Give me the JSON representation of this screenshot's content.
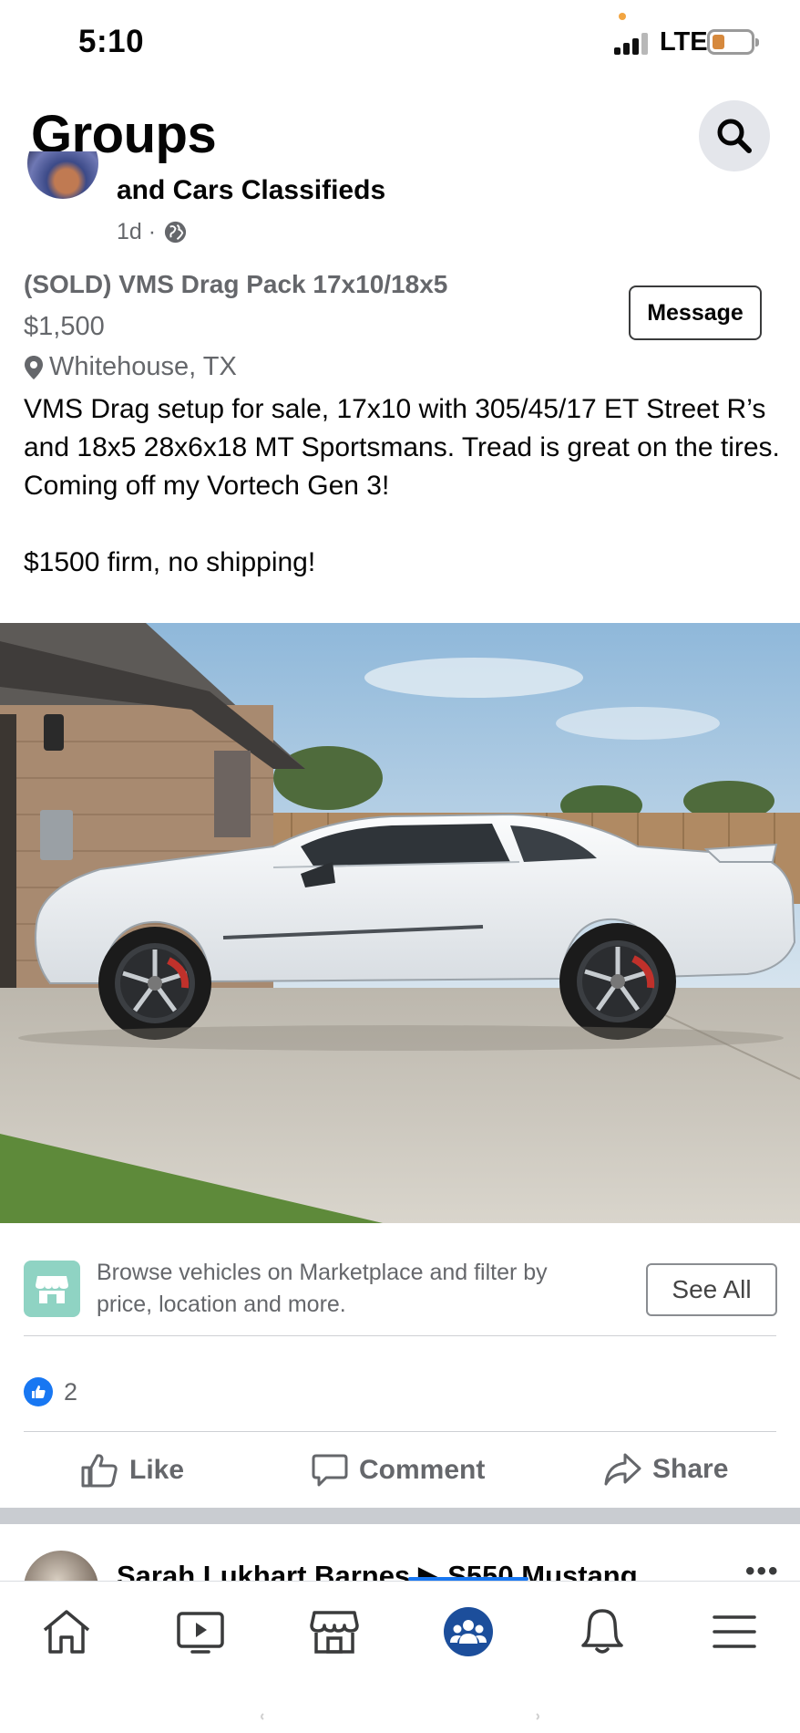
{
  "status_bar": {
    "time": "5:10",
    "network": "LTE",
    "battery_level": 0.2,
    "signal_bars": 3
  },
  "header": {
    "title": "Groups",
    "search_icon": "search-icon"
  },
  "post": {
    "group_name": "and Cars Classifieds",
    "time_ago": "1d ·",
    "privacy_icon": "globe-icon",
    "listing": {
      "title": "(SOLD) VMS Drag Pack 17x10/18x5",
      "price": "$1,500",
      "location": "Whitehouse, TX",
      "location_icon": "map-pin-icon",
      "message_label": "Message"
    },
    "body": "VMS Drag setup for sale, 17x10 with 305/45/17 ET Street R’s and 18x5 28x6x18 MT Sportsmans. Tread is great on the tires. Coming off my Vortech Gen 3!\n\n$1500 firm, no shipping!",
    "photo_icon": "post-photo",
    "promo": {
      "text": "Browse vehicles on Marketplace and filter by price, location and more.",
      "button": "See All",
      "icon": "marketplace-icon"
    },
    "reactions": {
      "count": "2",
      "icon": "like-reaction-icon"
    },
    "actions": {
      "like": "Like",
      "comment": "Comment",
      "share": "Share"
    }
  },
  "next_post": {
    "author_text": "Sarah Lukhart Barnes ▶ S550 Mustang"
  },
  "tab_bar": {
    "tabs": [
      "home-icon",
      "video-icon",
      "marketplace-icon",
      "groups-icon",
      "notifications-icon",
      "menu-icon"
    ],
    "active": "groups-icon"
  },
  "colors": {
    "accent": "#1877f2",
    "secondary_text": "#65676b",
    "promo_icon_bg": "#8fd3c3",
    "divider": "#ced0d4"
  }
}
